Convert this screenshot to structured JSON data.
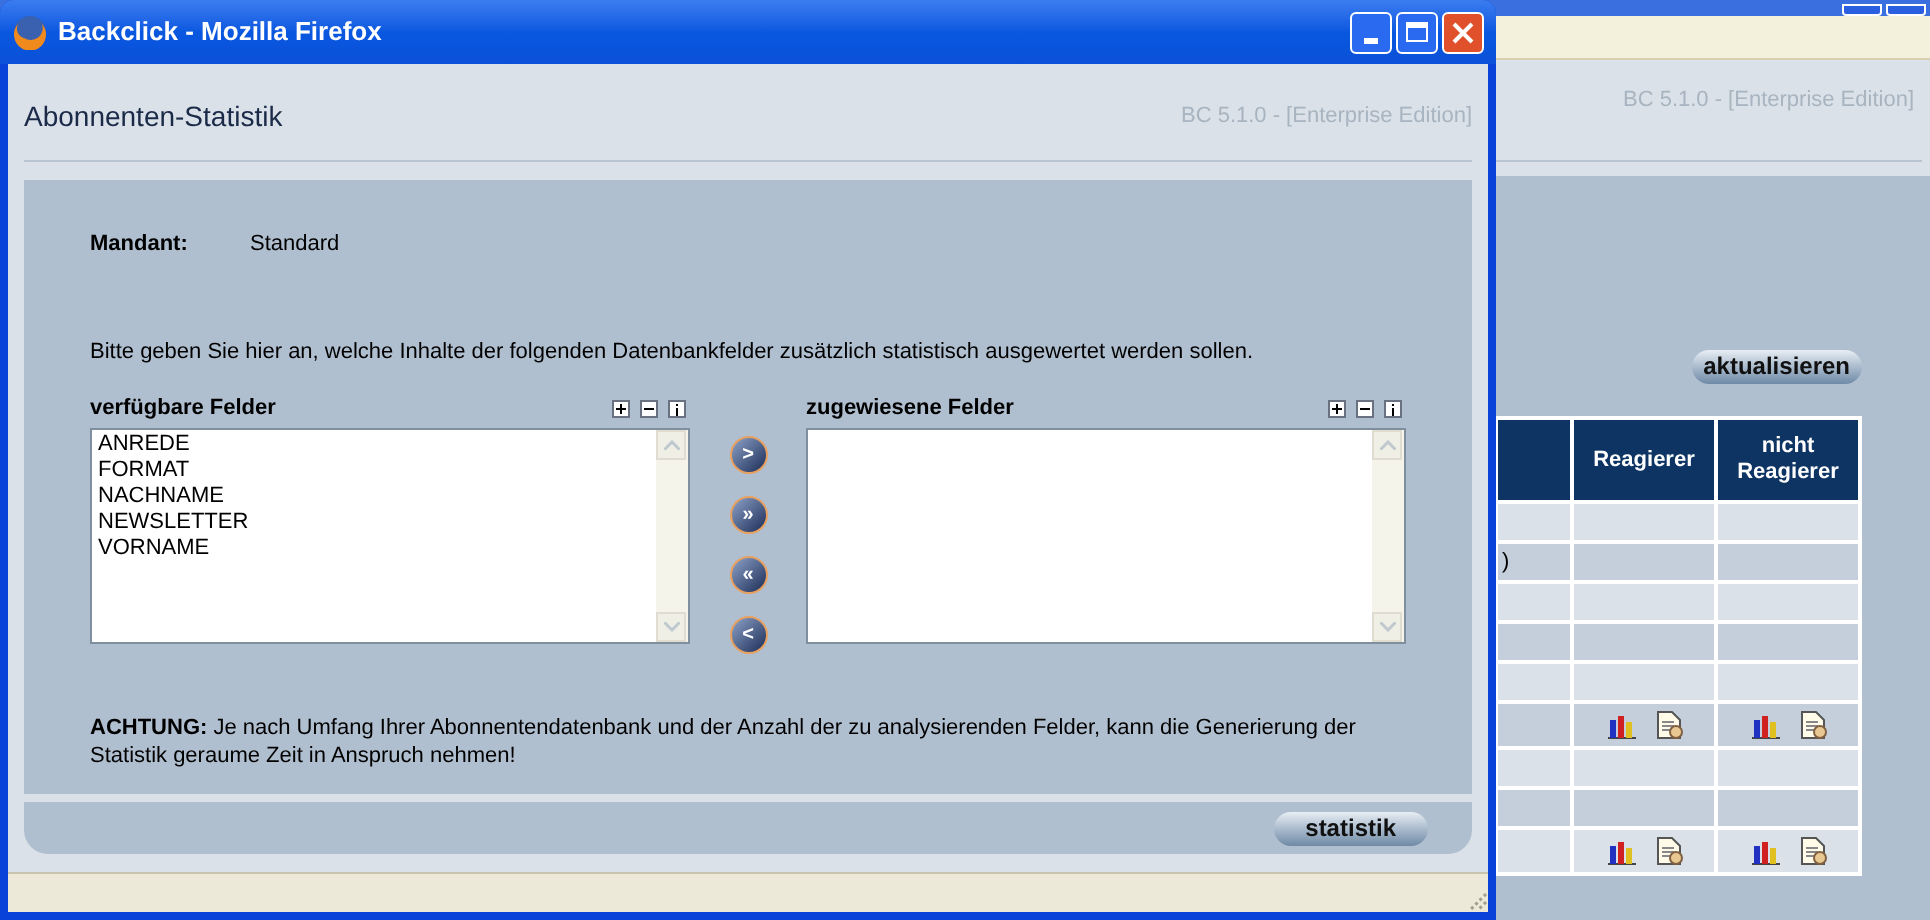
{
  "window": {
    "title": "Backclick - Mozilla Firefox"
  },
  "page": {
    "title": "Abonnenten-Statistik",
    "version": "BC 5.1.0 - [Enterprise Edition]"
  },
  "mandant": {
    "label": "Mandant:",
    "value": "Standard"
  },
  "instruction": "Bitte geben Sie hier an, welche Inhalte der folgenden Datenbankfelder zusätzlich statistisch ausgewertet werden sollen.",
  "available": {
    "label": "verfügbare Felder",
    "items": [
      "ANREDE",
      "FORMAT",
      "NACHNAME",
      "NEWSLETTER",
      "VORNAME"
    ]
  },
  "assigned": {
    "label": "zugewiesene Felder"
  },
  "transfer_buttons": [
    ">",
    "»",
    "«",
    "<"
  ],
  "warning": "**ACHTUNG:** Je nach Umfang Ihrer Abonnentendatenbank und der Anzahl der zu analysierenden Felder, kann die Generierung der Statistik geraume Zeit in Anspruch nehmen!",
  "submit": "statistik",
  "background_window": {
    "version": "BC 5.1.0 - [Enterprise Edition]",
    "refresh": "aktualisieren",
    "table": {
      "columns": [
        "Reagierer",
        "nicht Reagierer"
      ],
      "rows": [
        {
          "kind": "empty"
        },
        {
          "kind": "text",
          "text": ")"
        },
        {
          "kind": "empty"
        },
        {
          "kind": "empty"
        },
        {
          "kind": "empty"
        },
        {
          "kind": "icons"
        },
        {
          "kind": "empty"
        },
        {
          "kind": "empty"
        },
        {
          "kind": "icons"
        }
      ]
    }
  }
}
